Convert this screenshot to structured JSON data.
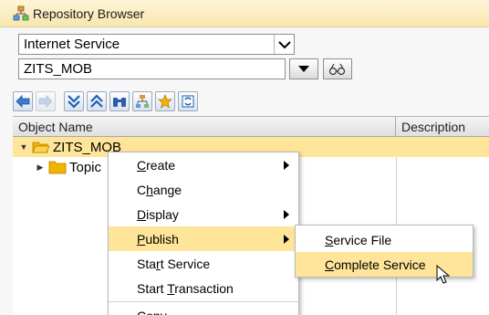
{
  "window": {
    "title": "Repository Browser"
  },
  "selector": {
    "object_type": "Internet Service",
    "object_name": "ZITS_MOB"
  },
  "toolbar": {
    "icons": [
      "back-icon",
      "forward-icon",
      "collapse-icon",
      "expand-icon",
      "find-icon",
      "hierarchy-icon",
      "favorites-icon",
      "refresh-icon"
    ]
  },
  "grid": {
    "columns": [
      "Object Name",
      "Description"
    ],
    "rows": [
      {
        "label": "ZITS_MOB",
        "expanded": true,
        "selected": true
      },
      {
        "label": "Topic",
        "expanded": false,
        "selected": false
      }
    ]
  },
  "context_menu": {
    "items": [
      {
        "label": "Create",
        "underline": "C",
        "submenu": true
      },
      {
        "label": "Change",
        "underline": "h",
        "submenu": false
      },
      {
        "label": "Display",
        "underline": "D",
        "submenu": true
      },
      {
        "label": "Publish",
        "underline": "P",
        "submenu": true,
        "highlighted": true
      },
      {
        "label": "Start Service",
        "underline": "r",
        "submenu": false
      },
      {
        "label": "Start Transaction",
        "underline": "T",
        "submenu": false
      },
      {
        "label": "Copy",
        "underline": "C",
        "submenu": false
      }
    ]
  },
  "submenu": {
    "items": [
      {
        "label": "Service File",
        "underline": "S"
      },
      {
        "label": "Complete Service",
        "underline": "C",
        "highlighted": true
      }
    ]
  },
  "colors": {
    "title_bg": "#f7e6ae",
    "selection": "#ffe59a",
    "folder": "#f2b400"
  }
}
